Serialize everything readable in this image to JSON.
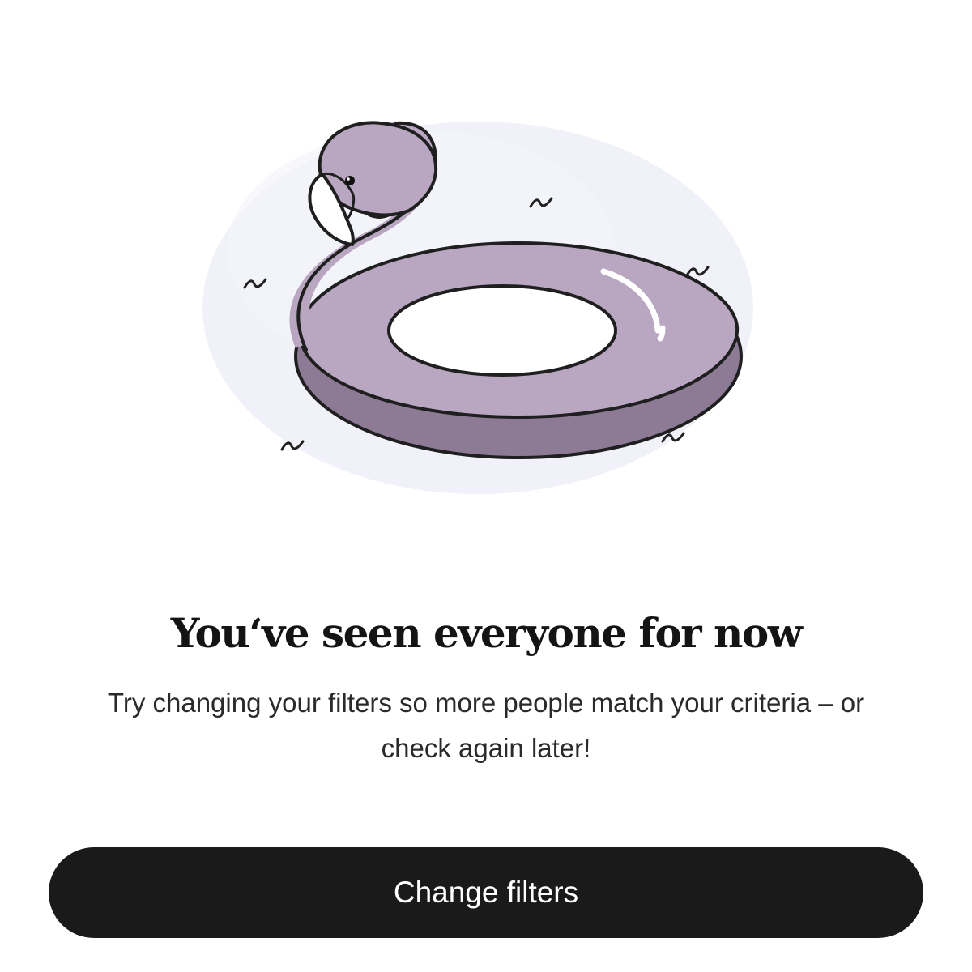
{
  "empty_state": {
    "illustration_icon": "flamingo-float-icon",
    "title": "You‘ve seen everyone for now",
    "message": "Try changing your filters so more people match your criteria – or check again later!"
  },
  "actions": {
    "change_filters_label": "Change filters"
  },
  "colors": {
    "background": "#ffffff",
    "float_body": "#b9a7c2",
    "float_shadow": "#8d7b96",
    "water_tint": "#eeeef8",
    "button_bg": "#1a1a1a",
    "button_text": "#ffffff",
    "headline": "#141414"
  }
}
